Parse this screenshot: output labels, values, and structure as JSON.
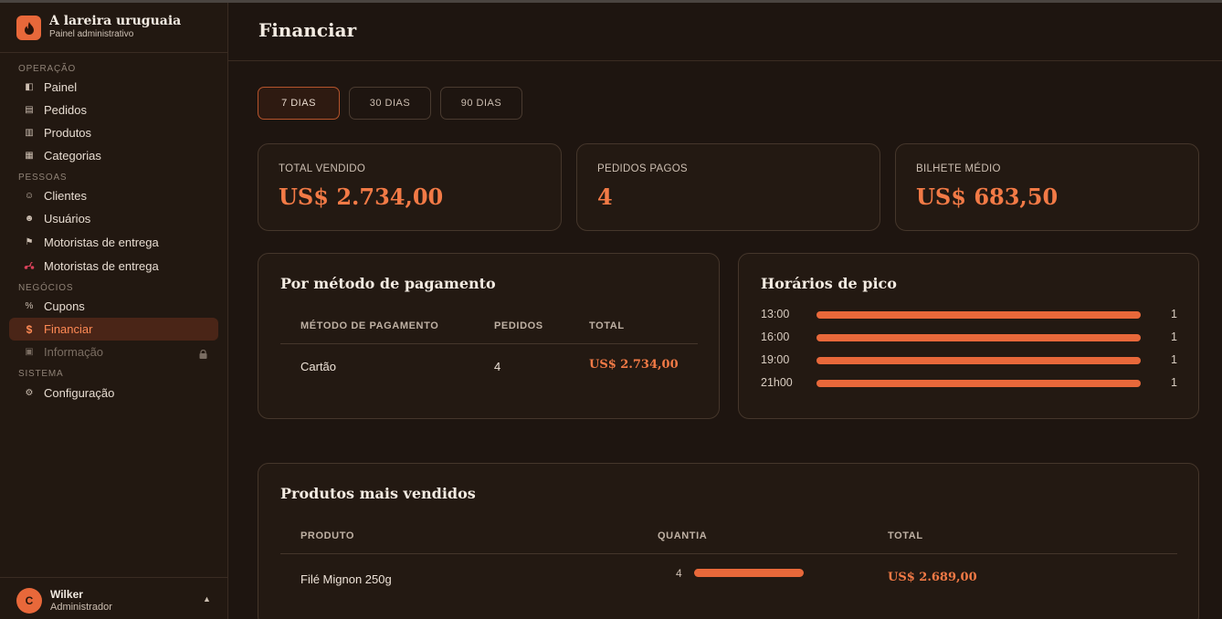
{
  "app": {
    "name": "A lareira uruguaia",
    "subtitle": "Painel administrativo",
    "accent_color": "#e8683a"
  },
  "sidebar": {
    "sections": [
      {
        "label": "OPERAÇÃO"
      },
      {
        "label": "PESSOAS"
      },
      {
        "label": "NEGÓCIOS"
      },
      {
        "label": "SISTEMA"
      }
    ],
    "items": [
      {
        "label": "Painel",
        "icon": "dashboard-icon",
        "glyph": "◧"
      },
      {
        "label": "Pedidos",
        "icon": "orders-icon",
        "glyph": "▤"
      },
      {
        "label": "Produtos",
        "icon": "products-icon",
        "glyph": "▥"
      },
      {
        "label": "Categorias",
        "icon": "categories-icon",
        "glyph": "▦"
      },
      {
        "label": "Clientes",
        "icon": "clients-icon",
        "glyph": "☺"
      },
      {
        "label": "Usuários",
        "icon": "users-icon",
        "glyph": "☻"
      },
      {
        "label": "Motoristas de entrega",
        "icon": "flag-icon",
        "glyph": "⚑"
      },
      {
        "label": "Motoristas de entrega",
        "icon": "scooter-icon",
        "glyph": "🛵"
      },
      {
        "label": "Cupons",
        "icon": "percent-icon",
        "glyph": "%"
      },
      {
        "label": "Financiar",
        "icon": "dollar-icon",
        "glyph": "$",
        "active": true
      },
      {
        "label": "Informação",
        "icon": "info-icon",
        "glyph": "▣",
        "disabled": true
      },
      {
        "label": "Configuração",
        "icon": "gear-icon",
        "glyph": "⚙"
      }
    ],
    "user": {
      "initial": "C",
      "name": "Wilker",
      "role": "Administrador",
      "caret": "▲"
    }
  },
  "page": {
    "title": "Financiar"
  },
  "ranges": {
    "options": [
      "7 DIAS",
      "30 DIAS",
      "90 DIAS"
    ],
    "selected": "7 DIAS"
  },
  "stats": [
    {
      "label": "TOTAL VENDIDO",
      "value": "US$ 2.734,00"
    },
    {
      "label": "PEDIDOS PAGOS",
      "value": "4"
    },
    {
      "label": "BILHETE MÉDIO",
      "value": "US$ 683,50"
    }
  ],
  "payment_methods": {
    "title": "Por método de pagamento",
    "columns": [
      "MÉTODO DE PAGAMENTO",
      "PEDIDOS",
      "TOTAL"
    ],
    "rows": [
      {
        "method": "Cartão",
        "orders": "4",
        "total": "US$ 2.734,00"
      }
    ]
  },
  "peak_hours": {
    "title": "Horários de pico",
    "rows": [
      {
        "hour": "13:00",
        "count": "1",
        "fraction": 1.0
      },
      {
        "hour": "16:00",
        "count": "1",
        "fraction": 1.0
      },
      {
        "hour": "19:00",
        "count": "1",
        "fraction": 1.0
      },
      {
        "hour": "21h00",
        "count": "1",
        "fraction": 1.0
      }
    ]
  },
  "top_products": {
    "title": "Produtos mais vendidos",
    "columns": [
      "PRODUTO",
      "QUANTIA",
      "TOTAL"
    ],
    "rows": [
      {
        "product": "Filé Mignon 250g",
        "quantity": "4",
        "quantity_fraction": 1.0,
        "total": "US$ 2.689,00"
      }
    ]
  }
}
